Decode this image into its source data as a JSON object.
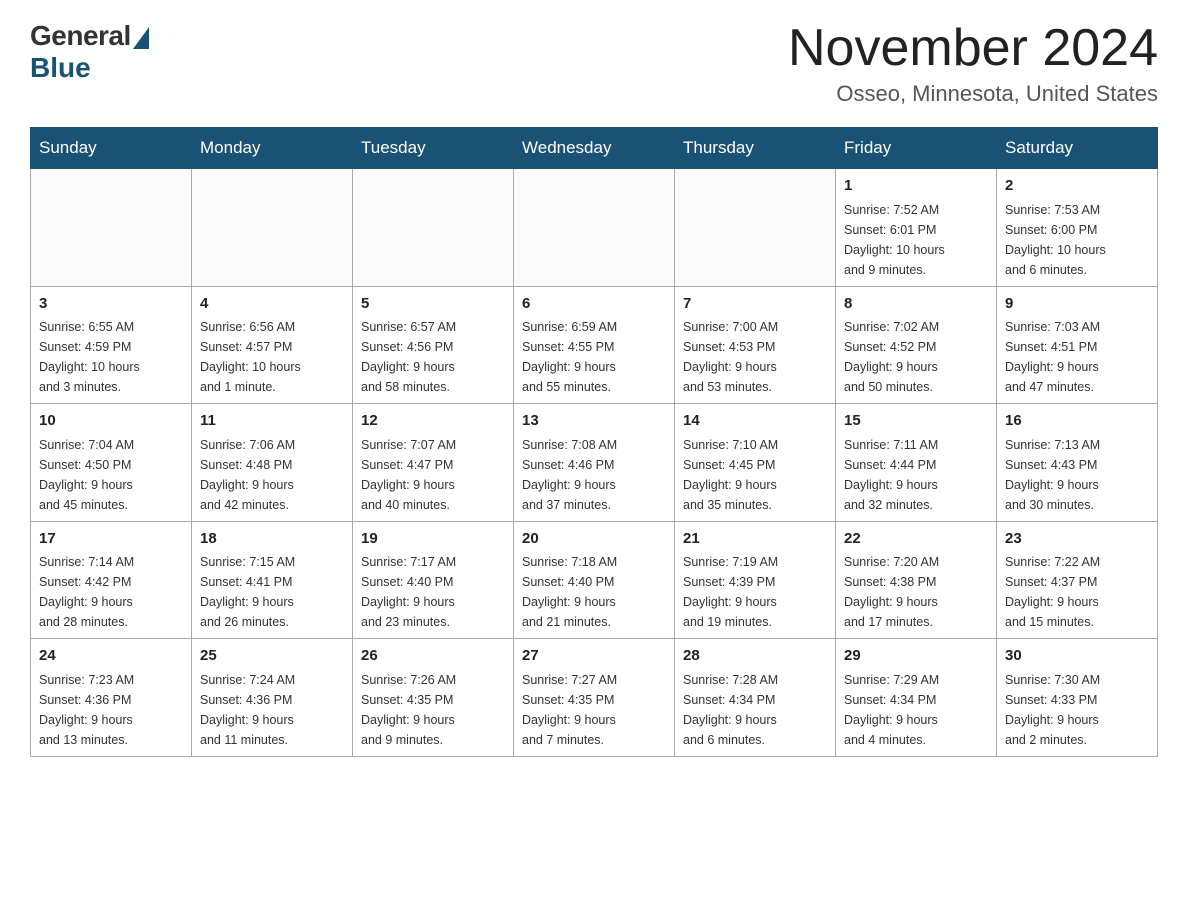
{
  "header": {
    "logo_general": "General",
    "logo_blue": "Blue",
    "month_title": "November 2024",
    "location": "Osseo, Minnesota, United States"
  },
  "weekdays": [
    "Sunday",
    "Monday",
    "Tuesday",
    "Wednesday",
    "Thursday",
    "Friday",
    "Saturday"
  ],
  "weeks": [
    [
      {
        "day": "",
        "info": ""
      },
      {
        "day": "",
        "info": ""
      },
      {
        "day": "",
        "info": ""
      },
      {
        "day": "",
        "info": ""
      },
      {
        "day": "",
        "info": ""
      },
      {
        "day": "1",
        "info": "Sunrise: 7:52 AM\nSunset: 6:01 PM\nDaylight: 10 hours\nand 9 minutes."
      },
      {
        "day": "2",
        "info": "Sunrise: 7:53 AM\nSunset: 6:00 PM\nDaylight: 10 hours\nand 6 minutes."
      }
    ],
    [
      {
        "day": "3",
        "info": "Sunrise: 6:55 AM\nSunset: 4:59 PM\nDaylight: 10 hours\nand 3 minutes."
      },
      {
        "day": "4",
        "info": "Sunrise: 6:56 AM\nSunset: 4:57 PM\nDaylight: 10 hours\nand 1 minute."
      },
      {
        "day": "5",
        "info": "Sunrise: 6:57 AM\nSunset: 4:56 PM\nDaylight: 9 hours\nand 58 minutes."
      },
      {
        "day": "6",
        "info": "Sunrise: 6:59 AM\nSunset: 4:55 PM\nDaylight: 9 hours\nand 55 minutes."
      },
      {
        "day": "7",
        "info": "Sunrise: 7:00 AM\nSunset: 4:53 PM\nDaylight: 9 hours\nand 53 minutes."
      },
      {
        "day": "8",
        "info": "Sunrise: 7:02 AM\nSunset: 4:52 PM\nDaylight: 9 hours\nand 50 minutes."
      },
      {
        "day": "9",
        "info": "Sunrise: 7:03 AM\nSunset: 4:51 PM\nDaylight: 9 hours\nand 47 minutes."
      }
    ],
    [
      {
        "day": "10",
        "info": "Sunrise: 7:04 AM\nSunset: 4:50 PM\nDaylight: 9 hours\nand 45 minutes."
      },
      {
        "day": "11",
        "info": "Sunrise: 7:06 AM\nSunset: 4:48 PM\nDaylight: 9 hours\nand 42 minutes."
      },
      {
        "day": "12",
        "info": "Sunrise: 7:07 AM\nSunset: 4:47 PM\nDaylight: 9 hours\nand 40 minutes."
      },
      {
        "day": "13",
        "info": "Sunrise: 7:08 AM\nSunset: 4:46 PM\nDaylight: 9 hours\nand 37 minutes."
      },
      {
        "day": "14",
        "info": "Sunrise: 7:10 AM\nSunset: 4:45 PM\nDaylight: 9 hours\nand 35 minutes."
      },
      {
        "day": "15",
        "info": "Sunrise: 7:11 AM\nSunset: 4:44 PM\nDaylight: 9 hours\nand 32 minutes."
      },
      {
        "day": "16",
        "info": "Sunrise: 7:13 AM\nSunset: 4:43 PM\nDaylight: 9 hours\nand 30 minutes."
      }
    ],
    [
      {
        "day": "17",
        "info": "Sunrise: 7:14 AM\nSunset: 4:42 PM\nDaylight: 9 hours\nand 28 minutes."
      },
      {
        "day": "18",
        "info": "Sunrise: 7:15 AM\nSunset: 4:41 PM\nDaylight: 9 hours\nand 26 minutes."
      },
      {
        "day": "19",
        "info": "Sunrise: 7:17 AM\nSunset: 4:40 PM\nDaylight: 9 hours\nand 23 minutes."
      },
      {
        "day": "20",
        "info": "Sunrise: 7:18 AM\nSunset: 4:40 PM\nDaylight: 9 hours\nand 21 minutes."
      },
      {
        "day": "21",
        "info": "Sunrise: 7:19 AM\nSunset: 4:39 PM\nDaylight: 9 hours\nand 19 minutes."
      },
      {
        "day": "22",
        "info": "Sunrise: 7:20 AM\nSunset: 4:38 PM\nDaylight: 9 hours\nand 17 minutes."
      },
      {
        "day": "23",
        "info": "Sunrise: 7:22 AM\nSunset: 4:37 PM\nDaylight: 9 hours\nand 15 minutes."
      }
    ],
    [
      {
        "day": "24",
        "info": "Sunrise: 7:23 AM\nSunset: 4:36 PM\nDaylight: 9 hours\nand 13 minutes."
      },
      {
        "day": "25",
        "info": "Sunrise: 7:24 AM\nSunset: 4:36 PM\nDaylight: 9 hours\nand 11 minutes."
      },
      {
        "day": "26",
        "info": "Sunrise: 7:26 AM\nSunset: 4:35 PM\nDaylight: 9 hours\nand 9 minutes."
      },
      {
        "day": "27",
        "info": "Sunrise: 7:27 AM\nSunset: 4:35 PM\nDaylight: 9 hours\nand 7 minutes."
      },
      {
        "day": "28",
        "info": "Sunrise: 7:28 AM\nSunset: 4:34 PM\nDaylight: 9 hours\nand 6 minutes."
      },
      {
        "day": "29",
        "info": "Sunrise: 7:29 AM\nSunset: 4:34 PM\nDaylight: 9 hours\nand 4 minutes."
      },
      {
        "day": "30",
        "info": "Sunrise: 7:30 AM\nSunset: 4:33 PM\nDaylight: 9 hours\nand 2 minutes."
      }
    ]
  ]
}
